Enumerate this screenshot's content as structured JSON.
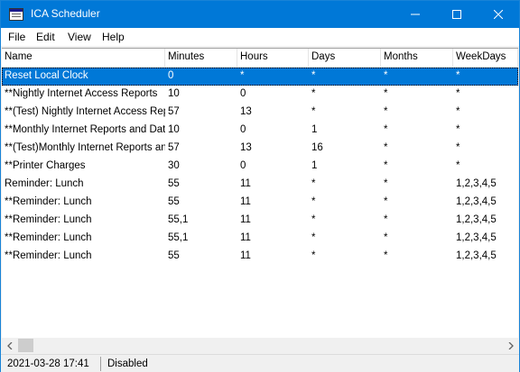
{
  "window": {
    "title": "ICA Scheduler"
  },
  "menu": [
    "File",
    "Edit",
    "View",
    "Help"
  ],
  "table": {
    "columns": [
      "Name",
      "Minutes",
      "Hours",
      "Days",
      "Months",
      "WeekDays"
    ],
    "rows": [
      [
        "Reset Local Clock",
        "0",
        "*",
        "*",
        "*",
        "*"
      ],
      [
        "**Nightly Internet Access Reports",
        "10",
        "0",
        "*",
        "*",
        "*"
      ],
      [
        "**(Test) Nightly Internet Access Repor",
        "57",
        "13",
        "*",
        "*",
        "*"
      ],
      [
        "**Monthly Internet Reports and Data",
        "10",
        "0",
        "1",
        "*",
        "*"
      ],
      [
        "**(Test)Monthly Internet Reports and D",
        "57",
        "13",
        "16",
        "*",
        "*"
      ],
      [
        "**Printer Charges",
        "30",
        "0",
        "1",
        "*",
        "*"
      ],
      [
        "Reminder: Lunch",
        "55",
        "11",
        "*",
        "*",
        "1,2,3,4,5"
      ],
      [
        "**Reminder: Lunch",
        "55",
        "11",
        "*",
        "*",
        "1,2,3,4,5"
      ],
      [
        "**Reminder: Lunch",
        "55,1",
        "11",
        "*",
        "*",
        "1,2,3,4,5"
      ],
      [
        "**Reminder: Lunch",
        "55,1",
        "11",
        "*",
        "*",
        "1,2,3,4,5"
      ],
      [
        "**Reminder: Lunch",
        "55",
        "11",
        "*",
        "*",
        "1,2,3,4,5"
      ]
    ],
    "selected_row": 0
  },
  "status": {
    "datetime": "2021-03-28 17:41",
    "state": "Disabled"
  },
  "colors": {
    "titlebar": "#0078d7",
    "selection": "#0078d7"
  }
}
